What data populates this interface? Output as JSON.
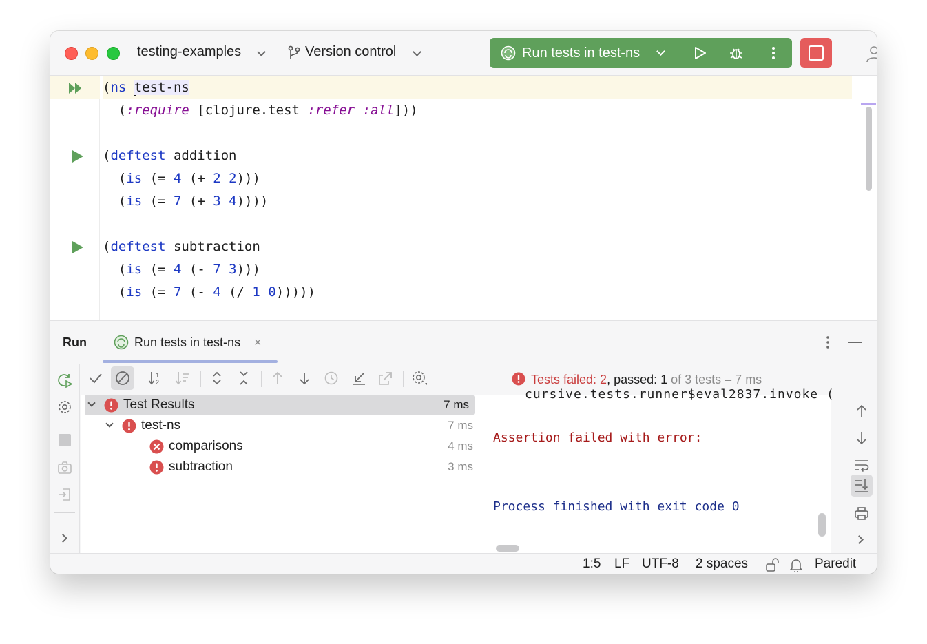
{
  "titlebar": {
    "project_name": "testing-examples",
    "version_control_label": "Version control",
    "run_config_label": "Run tests in test-ns"
  },
  "editor": {
    "lines": [
      {
        "parts": [
          [
            "p",
            "("
          ],
          [
            "k",
            "ns"
          ],
          [
            "p",
            " "
          ],
          [
            "caret",
            ""
          ],
          [
            "h",
            "test-ns"
          ]
        ]
      },
      {
        "parts": [
          [
            "p",
            "  ("
          ],
          [
            "w",
            ":require"
          ],
          [
            "p",
            " [clojure.test "
          ],
          [
            "w",
            ":refer"
          ],
          [
            "p",
            " "
          ],
          [
            "w",
            ":all"
          ],
          [
            "p",
            "]))"
          ]
        ]
      },
      {
        "parts": []
      },
      {
        "parts": [
          [
            "p",
            "("
          ],
          [
            "k",
            "deftest"
          ],
          [
            "p",
            " addition"
          ]
        ]
      },
      {
        "parts": [
          [
            "p",
            "  ("
          ],
          [
            "k",
            "is"
          ],
          [
            "p",
            " (= "
          ],
          [
            "n",
            "4"
          ],
          [
            "p",
            " (+ "
          ],
          [
            "n",
            "2"
          ],
          [
            "p",
            " "
          ],
          [
            "n",
            "2"
          ],
          [
            "p",
            ")))"
          ]
        ]
      },
      {
        "parts": [
          [
            "p",
            "  ("
          ],
          [
            "k",
            "is"
          ],
          [
            "p",
            " (= "
          ],
          [
            "n",
            "7"
          ],
          [
            "p",
            " (+ "
          ],
          [
            "n",
            "3"
          ],
          [
            "p",
            " "
          ],
          [
            "n",
            "4"
          ],
          [
            "p",
            "))))"
          ]
        ]
      },
      {
        "parts": []
      },
      {
        "parts": [
          [
            "p",
            "("
          ],
          [
            "k",
            "deftest"
          ],
          [
            "p",
            " subtraction"
          ]
        ]
      },
      {
        "parts": [
          [
            "p",
            "  ("
          ],
          [
            "k",
            "is"
          ],
          [
            "p",
            " (= "
          ],
          [
            "n",
            "4"
          ],
          [
            "p",
            " (- "
          ],
          [
            "n",
            "7"
          ],
          [
            "p",
            " "
          ],
          [
            "n",
            "3"
          ],
          [
            "p",
            ")))"
          ]
        ]
      },
      {
        "parts": [
          [
            "p",
            "  ("
          ],
          [
            "k",
            "is"
          ],
          [
            "p",
            " (= "
          ],
          [
            "n",
            "7"
          ],
          [
            "p",
            " (- "
          ],
          [
            "n",
            "4"
          ],
          [
            "p",
            " (/ "
          ],
          [
            "n",
            "1"
          ],
          [
            "p",
            " "
          ],
          [
            "n",
            "0"
          ],
          [
            "p",
            ")))))"
          ]
        ]
      }
    ]
  },
  "run_panel": {
    "title": "Run",
    "tab_label": "Run tests in test-ns",
    "tab_close": "×",
    "summary": {
      "failed_label": "Tests failed: 2",
      "passed_label": ", passed: 1",
      "total_label": " of 3 tests – 7 ms"
    },
    "tree": [
      {
        "label": "Test Results",
        "time": "7 ms",
        "status": "error",
        "selected": true,
        "level": 0,
        "expandable": true
      },
      {
        "label": "test-ns",
        "time": "7 ms",
        "status": "error",
        "selected": false,
        "level": 1,
        "expandable": true
      },
      {
        "label": "comparisons",
        "time": "4 ms",
        "status": "failed",
        "selected": false,
        "level": 2,
        "expandable": false
      },
      {
        "label": "subtraction",
        "time": "3 ms",
        "status": "error",
        "selected": false,
        "level": 2,
        "expandable": false
      }
    ],
    "console": {
      "cut_line": "cursive.tests.runner$eval2837.invoke (",
      "error_line": "Assertion failed with error:",
      "info_line": "Process finished with exit code 0"
    }
  },
  "statusbar": {
    "position": "1:5",
    "line_ending": "LF",
    "encoding": "UTF-8",
    "indent": "2 spaces",
    "mode": "Paredit"
  },
  "colors": {
    "run_green": "#5fa05b",
    "stop_red": "#e55c5c",
    "error_red": "#c93c3c",
    "keyword_blue": "#1d39c4",
    "keyword_purple": "#871094"
  }
}
